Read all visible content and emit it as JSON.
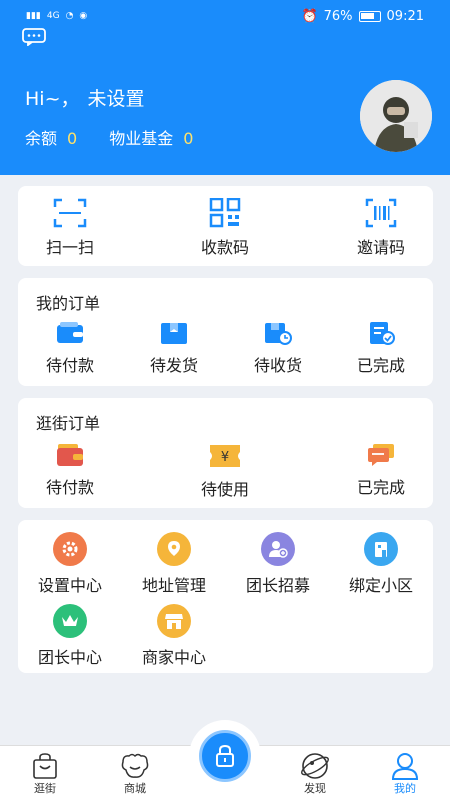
{
  "status": {
    "battery": "76%",
    "time": "09:21",
    "signal": "4G"
  },
  "profile": {
    "greeting": "Hi~，",
    "name": "未设置",
    "balance_label": "余额",
    "balance_value": "0",
    "fund_label": "物业基金",
    "fund_value": "0"
  },
  "quick": [
    {
      "label": "扫一扫",
      "icon": "scan-icon"
    },
    {
      "label": "收款码",
      "icon": "qr-code-icon"
    },
    {
      "label": "邀请码",
      "icon": "barcode-icon"
    }
  ],
  "orders": {
    "title": "我的订单",
    "items": [
      {
        "label": "待付款",
        "icon": "wallet-icon"
      },
      {
        "label": "待发货",
        "icon": "box-icon"
      },
      {
        "label": "待收货",
        "icon": "delivery-icon"
      },
      {
        "label": "已完成",
        "icon": "completed-icon"
      }
    ]
  },
  "street_orders": {
    "title": "逛街订单",
    "items": [
      {
        "label": "待付款",
        "icon": "wallet-icon"
      },
      {
        "label": "待使用",
        "icon": "coupon-icon"
      },
      {
        "label": "已完成",
        "icon": "chat-icon"
      }
    ]
  },
  "services": [
    {
      "label": "设置中心",
      "icon": "gear-icon",
      "color": "#f07a4a"
    },
    {
      "label": "地址管理",
      "icon": "location-icon",
      "color": "#f5b53a"
    },
    {
      "label": "团长招募",
      "icon": "user-add-icon",
      "color": "#8a85e0"
    },
    {
      "label": "绑定小区",
      "icon": "building-icon",
      "color": "#3aa7f0"
    },
    {
      "label": "团长中心",
      "icon": "crown-icon",
      "color": "#2cc07a"
    },
    {
      "label": "商家中心",
      "icon": "shop-icon",
      "color": "#f5b53a"
    }
  ],
  "nav": [
    {
      "label": "逛街",
      "icon": "shopping-bag-icon"
    },
    {
      "label": "商城",
      "icon": "mall-icon"
    },
    {
      "label": "发现",
      "icon": "compass-icon"
    },
    {
      "label": "我的",
      "icon": "profile-icon"
    }
  ],
  "colors": {
    "brand": "#1a8cfb",
    "accent_value": "#ffe26a"
  }
}
